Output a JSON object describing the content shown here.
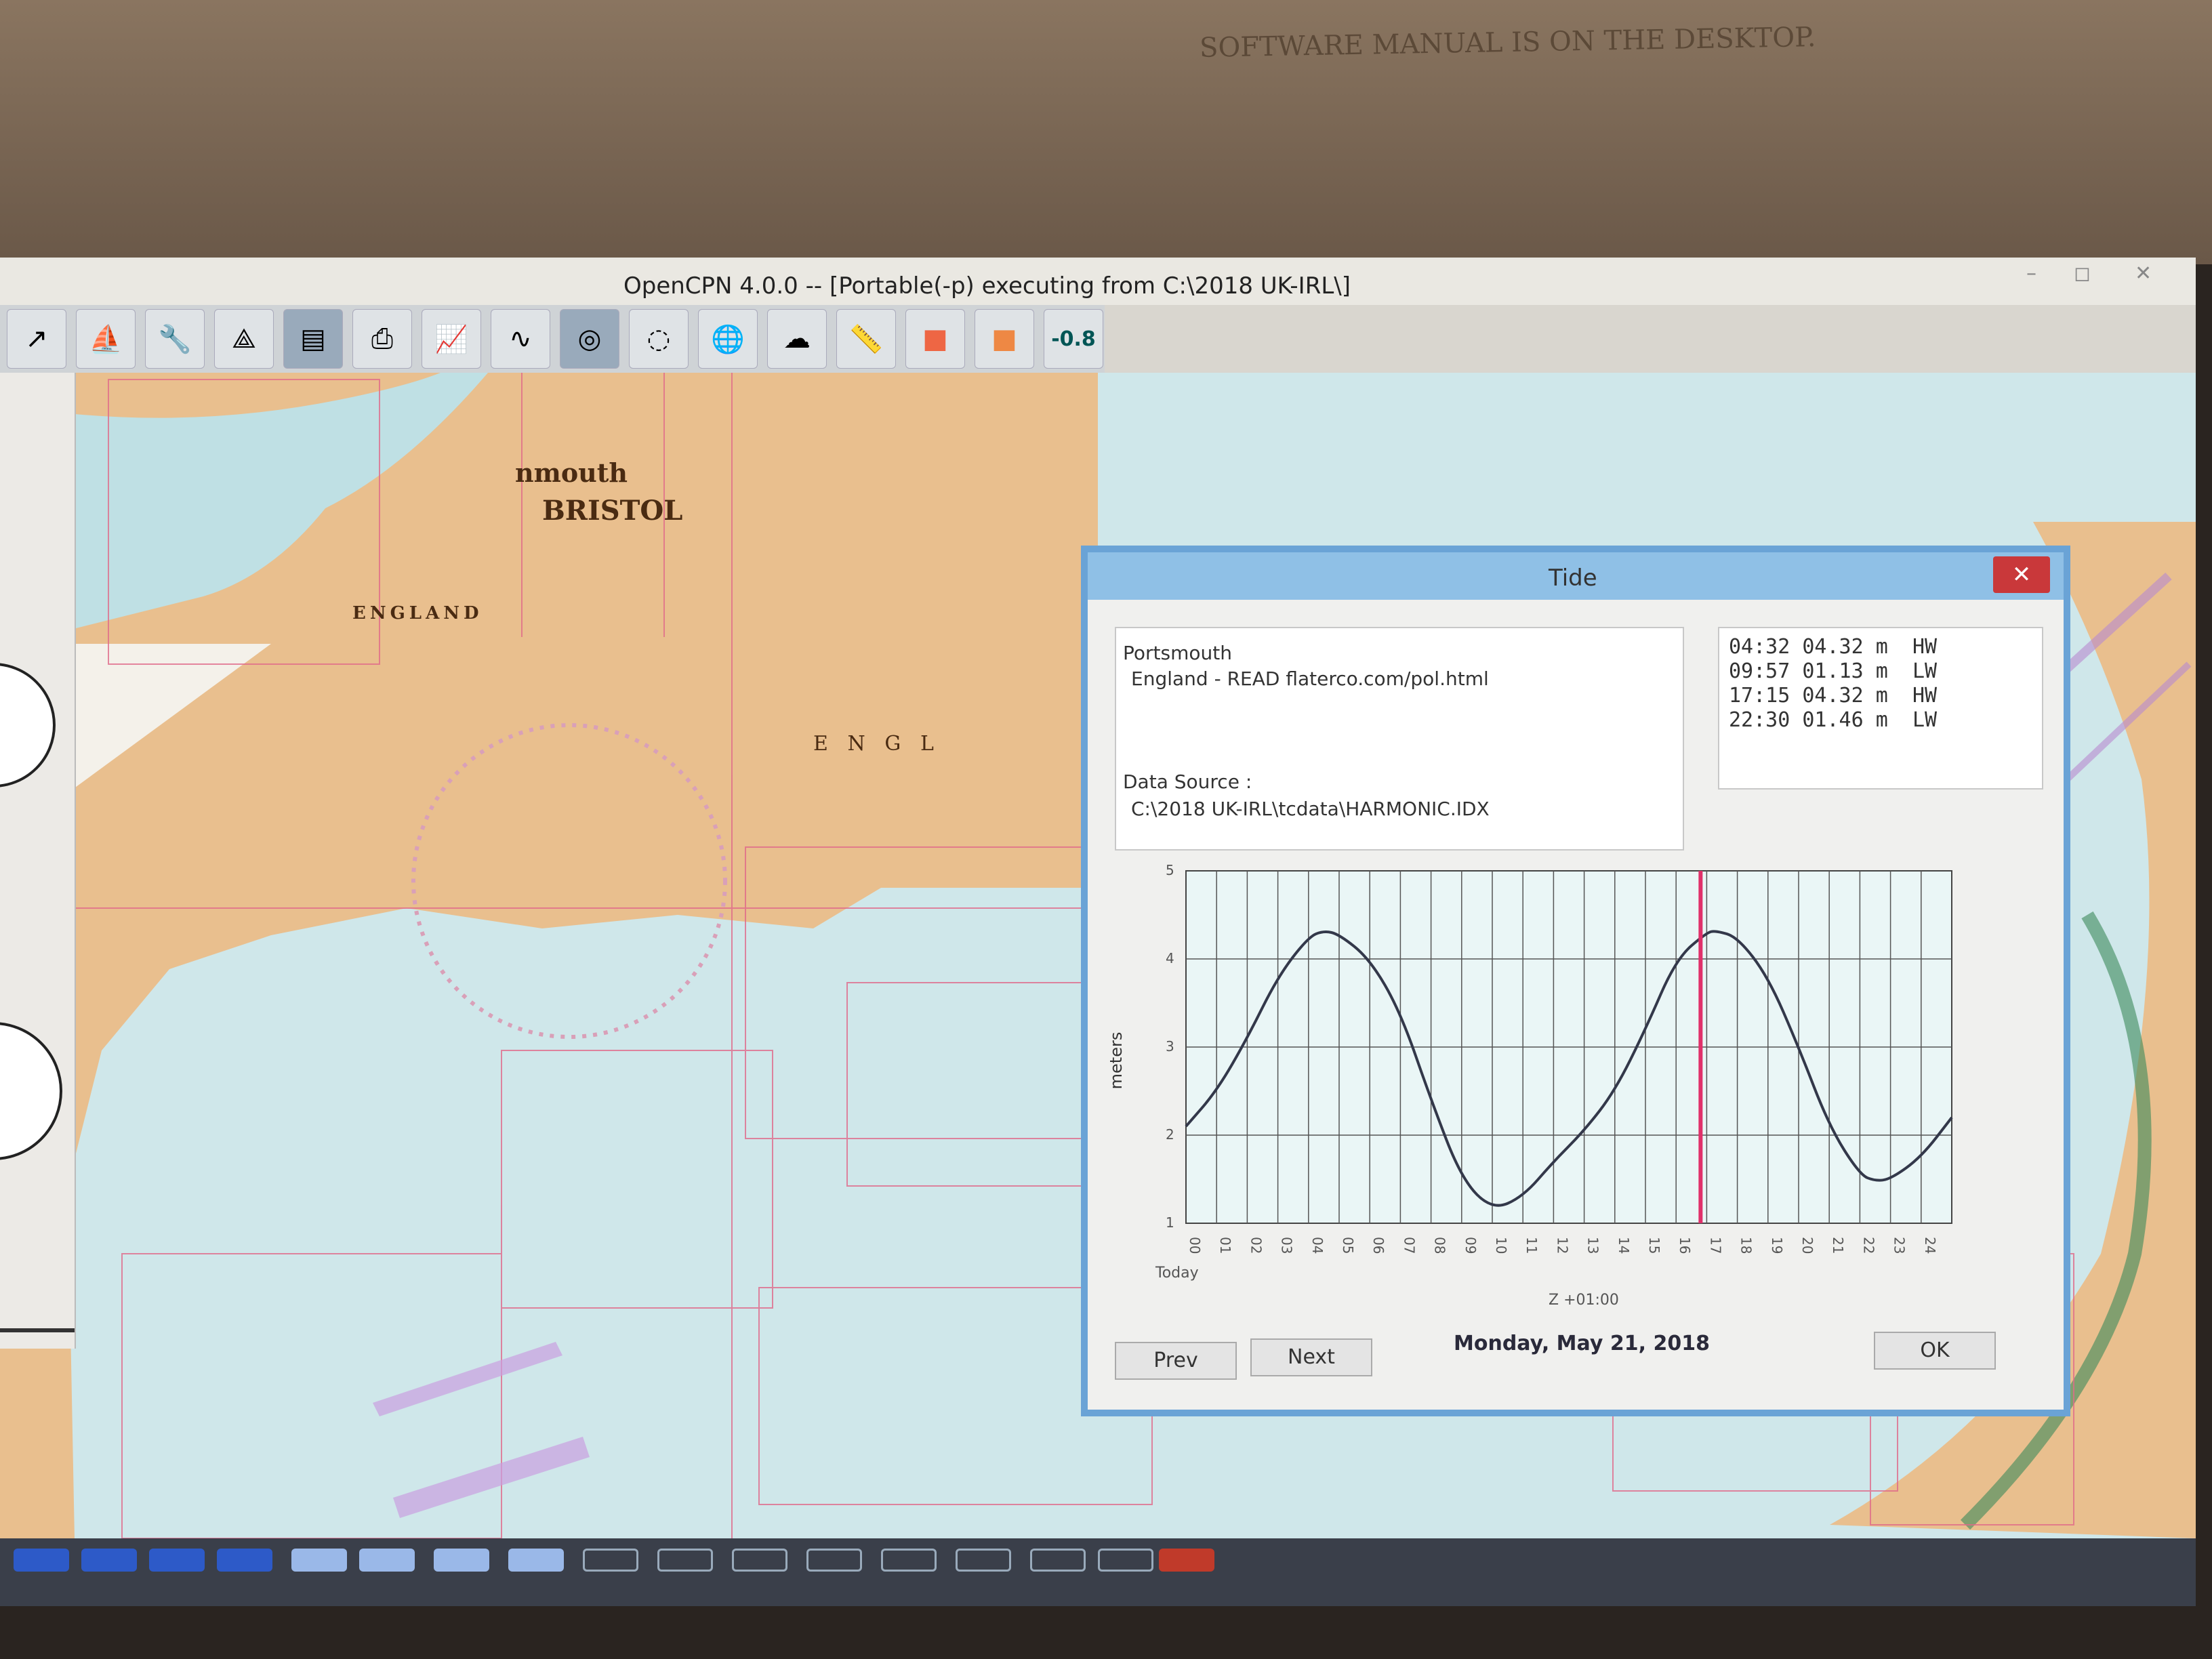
{
  "window": {
    "title": "OpenCPN 4.0.0 -- [Portable(-p) executing from C:\\2018 UK-IRL\\]",
    "minimize": "–",
    "maximize": "◻",
    "close": "✕"
  },
  "background": {
    "manual_note": "SOFTWARE MANUAL IS ON THE DESKTOP."
  },
  "toolbar": {
    "zoom_readout": "-0.8"
  },
  "map": {
    "labels": {
      "bristol": "BRISTOL",
      "nmouth": "nmouth",
      "england_small": "ENGLAND",
      "england_large": "E   N   G   L"
    }
  },
  "tide_dialog": {
    "title": "Tide",
    "close_label": "✕",
    "station": "Portsmouth",
    "region": "England - READ flaterco.com/pol.html",
    "data_source_label": "Data Source :",
    "data_source_path": "C:\\2018 UK-IRL\\tcdata\\HARMONIC.IDX",
    "tide_times": [
      {
        "time": "04:32",
        "height": "04.32 m",
        "type": "HW"
      },
      {
        "time": "09:57",
        "height": "01.13 m",
        "type": "LW"
      },
      {
        "time": "17:15",
        "height": "04.32 m",
        "type": "HW"
      },
      {
        "time": "22:30",
        "height": "01.46 m",
        "type": "LW"
      }
    ],
    "prev_label": "Prev",
    "next_label": "Next",
    "ok_label": "OK",
    "date": "Monday, May 21, 2018",
    "today_label": "Today",
    "timezone": "Z +01:00",
    "ylabel": "meters"
  },
  "chart_data": {
    "type": "line",
    "ylabel": "meters",
    "xlabel": "Z +01:00",
    "ylim": [
      1,
      5
    ],
    "xlim": [
      0,
      25
    ],
    "y_ticks": [
      "1",
      "2",
      "3",
      "4",
      "5"
    ],
    "x_ticks": [
      "00",
      "01",
      "02",
      "03",
      "04",
      "05",
      "06",
      "07",
      "08",
      "09",
      "10",
      "11",
      "12",
      "13",
      "14",
      "15",
      "16",
      "17",
      "18",
      "19",
      "20",
      "21",
      "22",
      "23",
      "24"
    ],
    "current_time_marker": 16.8,
    "series": [
      {
        "x": [
          0,
          1,
          2,
          3,
          4,
          4.5,
          5,
          6,
          7,
          8,
          9,
          10,
          11,
          12,
          13,
          14,
          15,
          16,
          17,
          17.3,
          18,
          19,
          20,
          21,
          22,
          22.5,
          23,
          24,
          25
        ],
        "values": [
          2.1,
          2.5,
          3.1,
          3.8,
          4.25,
          4.32,
          4.28,
          4.0,
          3.4,
          2.4,
          1.5,
          1.15,
          1.3,
          1.7,
          2.05,
          2.5,
          3.2,
          4.0,
          4.3,
          4.32,
          4.25,
          3.8,
          3.0,
          2.1,
          1.55,
          1.48,
          1.5,
          1.75,
          2.2
        ]
      }
    ]
  }
}
